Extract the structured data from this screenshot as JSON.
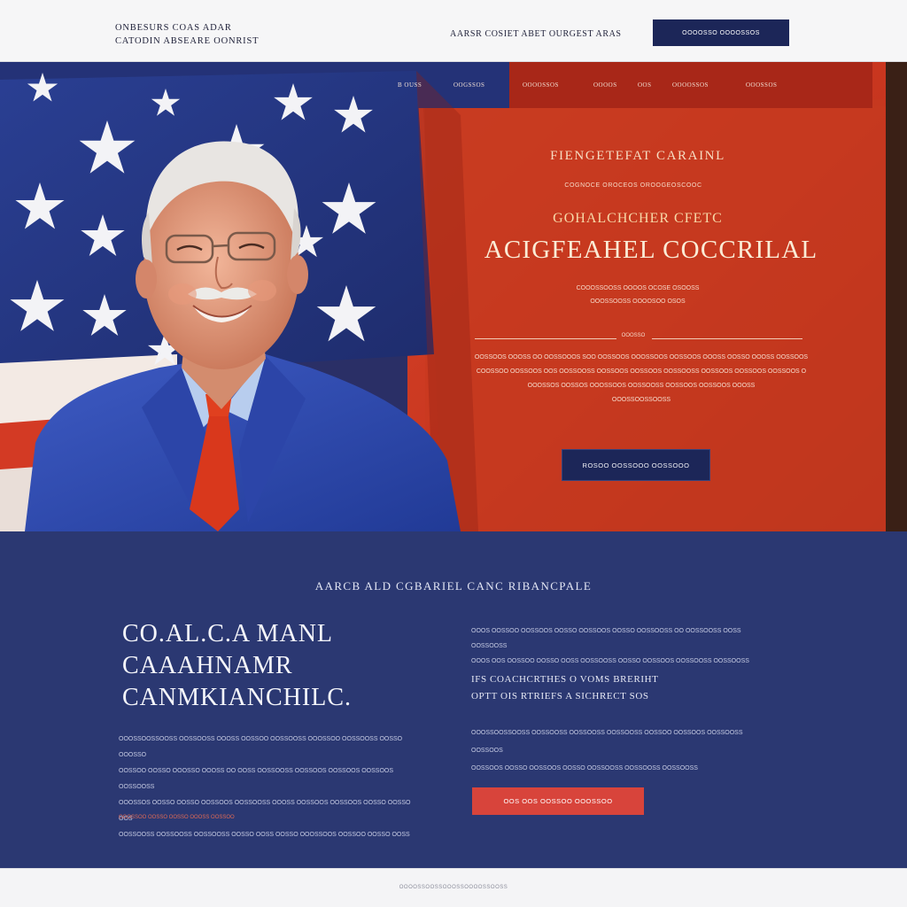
{
  "header": {
    "brand_line1": "ONBESURS COAS ADAR",
    "brand_line2": "CATODIN ABSEARE OONRIST",
    "nav_text": "AARSR COSIET  ABET   OURGEST ARAS",
    "cta_label": "OOOOSSO        OOOOSSOS"
  },
  "hero": {
    "nav": [
      "B OUSS",
      "OOGSSOS",
      "OOOOSSOS",
      "OOOOS",
      "OOS",
      "OOOOSSOS",
      "OOOSSOS"
    ],
    "kicker": "FIENGETEFAT CARAINL",
    "eyebrow": "COGNOCE OROCEOS OROOGEOSCOOC",
    "subtitle": "GOHALCHCHER CFETC",
    "title": "ACIGFEAHEL COCCRILAL",
    "note_line1": "COOOSSOOSS OOOOS OCOSE OSOOSS",
    "note_line2": "OOOSSOOSS OOOOSOO OSOS",
    "divider_label": "OOOSSO",
    "body_lines": [
      "OOSSOOS OOOSS OO OOSSOOOS SOO OOSSOOS OOOSSOOS OOSSOOS OOOSS OOSSO OOOSS OOSSOOS",
      "COOSSOO OOSSOOS OOS OOSSOOSS OOSSOOS OOSSOOS OOSSOOSS OOSSOOS OOSSOOS OOSSOOS O",
      "OOOSSOS OOSSOS OOOSSOOS OOSSOOSS OOSSOOS OOSSOOS OOOSS",
      "OOOSSOOSSOOSS"
    ],
    "cta_label": "ROSOO OOSSOOO OOSSOOO"
  },
  "section": {
    "kicker": "AARCB ALD CGBARIEL CANC RIBANCPALE",
    "title_line1": "CO.AL.C.A MANL",
    "title_line2": "CAAAHNAMR",
    "title_line3": "CANMKIANCHILC.",
    "left_lines": [
      "OOOSSOOSSOOSS OOSSOOSS OOOSS OOSSOO OOSSOOSS OOOSSOO OOSSOOSS OOSSO OOOSSO",
      "OOSSOO OOSSO OOOSSO OOOSS OO OOSS OOSSOOSS OOSSOOS OOSSOOS OOSSOOS OOSSOOSS",
      "OOOSSOS OOSSO OOSSO OOSSOOS OOSSOOSS OOOSS OOSSOOS OOSSOOS OOSSO OOSSO OOS",
      "OOSSOOSS OOSSOOSS OOSSOOSS OOSSO OOSS OOSSO OOOSSOOS OOSSOO OOSSO OOSS"
    ],
    "left_accent": "OOOSSOO OOSSO OOSSO OOOSS OOSSOO",
    "right_lines": [
      "OOOS OOSSOO OOSSOOS OOSSO OOSSOOS OOSSO OOSSOOSS OO OOSSOOSS OOSS OOSSOOSS",
      "OOOS OOS OOSSOO OOSSO OOSS OOSSOOSS OOSSO OOSSOOS OOSSOOSS OOSSOOSS"
    ],
    "sub_line1": "IFS COACHCRTHES O VOMS  BRERIHT",
    "sub_line2": "OPTT OIS  RTRIEFS A SICHRECT SOS",
    "right_lines2": [
      "OOOSSOOSSOOSS OOSSOOSS OOSSOOSS OOSSOOSS OOSSOO OOSSOOS OOSSOOSS OOSSOOS",
      "OOSSOOS OOSSO OOSSOOS OOSSO OOSSOOSS OOSSOOSS OOSSOOSS"
    ],
    "cta_label": "OOS OOS OOSSOO OOOSSOO"
  },
  "footer": {
    "line": "OOOOSSOOSSOOOSSOOOOSSOOSS"
  },
  "colors": {
    "navy": "#1c2658",
    "section_blue": "#2b3872",
    "flag_red": "#c73422",
    "accent_red": "#d8443b",
    "gold_text": "#f7d9a8"
  },
  "icons": [
    "star-icon"
  ]
}
